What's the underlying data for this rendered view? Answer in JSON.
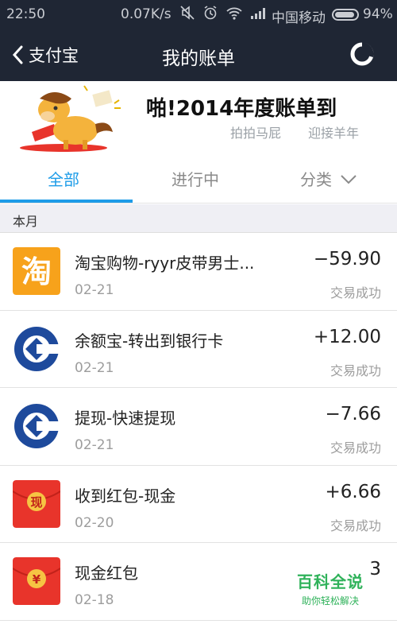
{
  "status_bar": {
    "time": "22:50",
    "speed": "0.07K/s",
    "carrier": "中国移动",
    "battery_percent": "94%",
    "battery_level": 0.94,
    "icons": [
      "mute-icon",
      "alarm-icon",
      "wifi-icon",
      "signal-icon"
    ]
  },
  "nav": {
    "back_label": "支付宝",
    "title": "我的账单"
  },
  "banner": {
    "title": "啪!2014年度账单到",
    "sub1": "拍拍马屁",
    "sub2": "迎接羊年"
  },
  "tabs": [
    {
      "label": "全部",
      "active": true
    },
    {
      "label": "进行中",
      "active": false
    },
    {
      "label": "分类",
      "active": false
    }
  ],
  "section_label": "本月",
  "transactions": [
    {
      "title": "淘宝购物-ryyr皮带男士...",
      "date": "02-21",
      "amount": "−59.90",
      "status": "交易成功",
      "icon": "taobao-icon",
      "icon_text": "淘"
    },
    {
      "title": "余额宝-转出到银行卡",
      "date": "02-21",
      "amount": "+12.00",
      "status": "交易成功",
      "icon": "ccb-bank-icon"
    },
    {
      "title": "提现-快速提现",
      "date": "02-21",
      "amount": "−7.66",
      "status": "交易成功",
      "icon": "ccb-bank-icon"
    },
    {
      "title": "收到红包-现金",
      "date": "02-20",
      "amount": "+6.66",
      "status": "交易成功",
      "icon": "red-envelope-icon",
      "icon_text": "现"
    },
    {
      "title": "现金红包",
      "date": "02-18",
      "amount": "3",
      "status": "",
      "icon": "red-envelope-icon",
      "icon_text": "¥"
    }
  ],
  "watermark": {
    "main": "百科全说",
    "sub": "助你轻松解决"
  },
  "colors": {
    "header_bg": "#1f2634",
    "accent": "#1e9ce8",
    "taobao_orange": "#f7a21b",
    "ccb_blue": "#1e4a9c",
    "red_envelope": "#e8342b",
    "watermark_green": "#2fb25a"
  }
}
